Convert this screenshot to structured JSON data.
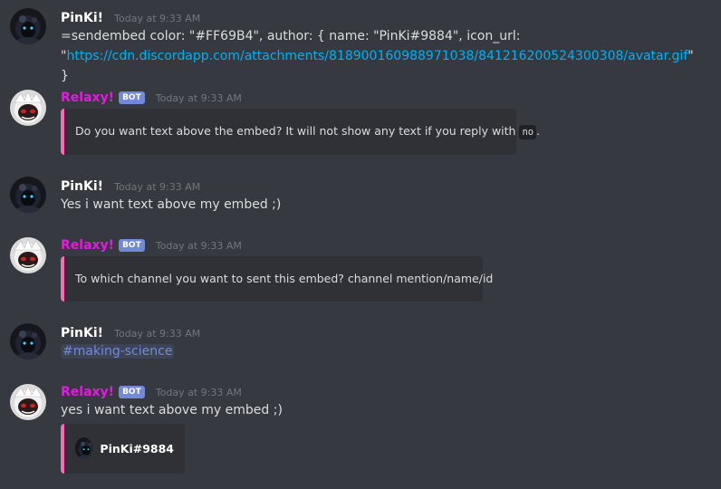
{
  "messages": [
    {
      "author": "PinKi!",
      "timestamp": "Today at 9:33 AM",
      "text_prefix": "=sendembed color: \"#FF69B4\", author: { name: \"PinKi#9884\", icon_url: \"",
      "link": "https://cdn.discordapp.com/attachments/818900160988971038/841216200524300308/avatar.gif",
      "text_suffix": "\" }"
    },
    {
      "author": "Relaxy!",
      "badge": "BOT",
      "timestamp": "Today at 9:33 AM",
      "embed_text": "Do you want text above the embed? It will not show any text if you reply with",
      "embed_code": "no",
      "embed_after": "."
    },
    {
      "author": "PinKi!",
      "timestamp": "Today at 9:33 AM",
      "text": "Yes i want text above my embed ;)"
    },
    {
      "author": "Relaxy!",
      "badge": "BOT",
      "timestamp": "Today at 9:33 AM",
      "embed_text": "To which channel you want to sent this embed? channel mention/name/id"
    },
    {
      "author": "PinKi!",
      "timestamp": "Today at 9:33 AM",
      "channel_mention": "#making-science"
    },
    {
      "author": "Relaxy!",
      "badge": "BOT",
      "timestamp": "Today at 9:33 AM",
      "text": "yes i want text above my embed ;)",
      "embed_author": "PinKi#9884"
    }
  ],
  "colors": {
    "background": "#36393f",
    "embed_accent": "#ff69b4",
    "bot_name": "#e01ddf",
    "link": "#00b0f4",
    "bot_badge": "#7289da"
  },
  "icons": {
    "pinki_avatar": "pinki-avatar-icon",
    "relaxy_avatar": "relaxy-avatar-icon"
  }
}
